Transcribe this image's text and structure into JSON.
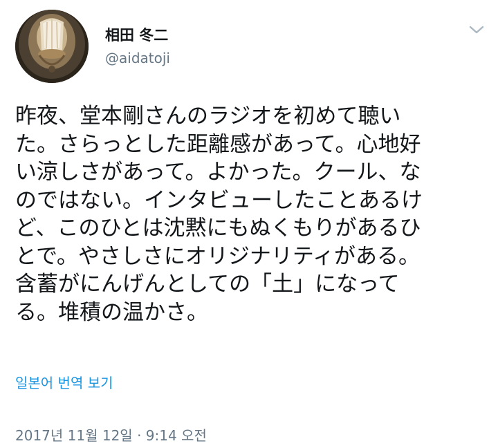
{
  "tweet": {
    "author": {
      "display_name": "相田 冬二",
      "handle": "@aidatoji"
    },
    "text_lines": [
      "昨夜、堂本剛さんのラジオを初めて聴い",
      "た。さらっとした距離感があって。心地好",
      "い涼しさがあって。よかった。クール、な",
      "のではない。インタビューしたことあるけ",
      "ど、このひとは沈黙にもぬくもりがあるひ",
      "とで。やさしさにオリジナリティがある。",
      "含蓄がにんげんとしての「土」になって",
      "る。堆積の温かさ。"
    ],
    "translate_label": "일본어 번역 보기",
    "timestamp": "2017년 11월 12일 · 9:14 오전"
  },
  "colors": {
    "text": "#14171a",
    "secondary": "#657786",
    "link": "#1b95e0",
    "chevron": "#aab8c2"
  }
}
